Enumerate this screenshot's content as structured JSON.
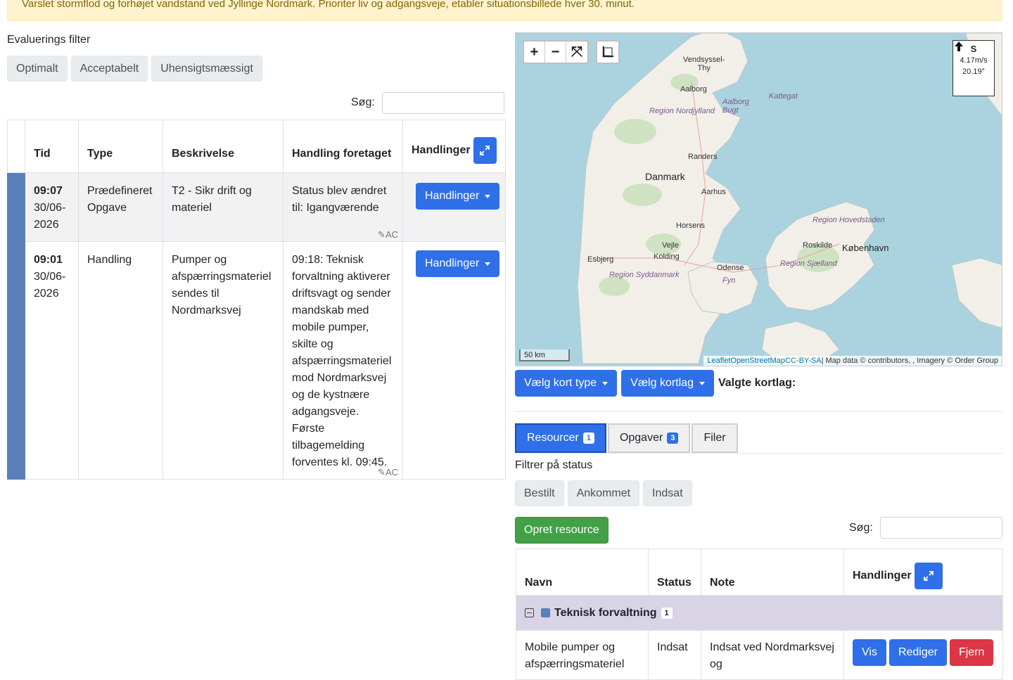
{
  "banner": {
    "text": "Varslet stormflod og forhøjet vandstand ved Jyllinge Nordmark. Prioriter liv og adgangsveje, etabler situationsbillede hver 30. minut."
  },
  "evaluation_filter": {
    "label": "Evaluerings filter",
    "buttons": [
      "Optimalt",
      "Acceptabelt",
      "Uhensigtsmæssigt"
    ]
  },
  "events_search": {
    "label": "Søg:",
    "value": ""
  },
  "events_table": {
    "headers": {
      "time": "Tid",
      "type": "Type",
      "description": "Beskrivelse",
      "action": "Handling foretaget",
      "actions": "Handlinger"
    },
    "rows": [
      {
        "time": "09:07",
        "date": "30/06-2026",
        "type": "Prædefineret Opgave",
        "description": "T2 - Sikr drift og materiel",
        "action": "Status blev ændret til: Igangværende",
        "author": "✎AC",
        "actions_label": "Handlinger"
      },
      {
        "time": "09:01",
        "date": "30/06-2026",
        "type": "Handling",
        "description": "Pumper og afspærringsmateriel sendes til Nordmarksvej",
        "action": "09:18: Teknisk forvaltning aktiverer driftsvagt og sender mandskab med mobile pumper, skilte og afspærringsmateriel mod Nordmarksvej og de kystnære adgangsveje. Første tilbagemelding forventes kl. 09:45.",
        "author": "✎AC",
        "actions_label": "Handlinger"
      }
    ]
  },
  "map": {
    "labels": {
      "vendsyssel": "Vendsyssel-\nThy",
      "aalborg": "Aalborg",
      "aalborg_bugt": "Aalborg\nBugt",
      "kattegat": "Kattegat",
      "region_nord": "Region Nordjylland",
      "randers": "Randers",
      "danmark": "Danmark",
      "aarhus": "Aarhus",
      "horsens": "Horsens",
      "region_hoved": "Region Hovedstaden",
      "roskilde": "Roskilde",
      "kobenhavn": "København",
      "vejle": "Vejle",
      "kolding": "Kolding",
      "esbjerg": "Esbjerg",
      "odense": "Odense",
      "fyn": "Fyn",
      "region_sjaelland": "Region Sjælland",
      "region_syd": "Region Syddanmark"
    },
    "wind": {
      "direction": "S",
      "speed": "4.17m/s",
      "degrees": "20.19°"
    },
    "scale": "50 km",
    "attribution": {
      "leaflet": "Leaflet",
      "osm": "OpenStreetMap",
      "cc": "CC-BY-SA",
      "rest": "| Map data © contributors, , Imagery © Order Group"
    },
    "controls": {
      "zoom_in": "+",
      "zoom_out": "−",
      "fit": "⤧"
    }
  },
  "map_tools": {
    "map_type": "Vælg kort type",
    "layer": "Vælg kortlag",
    "selected_layers": "Valgte kortlag:"
  },
  "tabs": [
    {
      "label": "Resourcer",
      "count": "1"
    },
    {
      "label": "Opgaver",
      "count": "3"
    },
    {
      "label": "Filer",
      "count": ""
    }
  ],
  "status_filter": {
    "label": "Filtrer på status",
    "buttons": [
      "Bestilt",
      "Ankommet",
      "Indsat"
    ]
  },
  "create_resource": "Opret resource",
  "resources_search": {
    "label": "Søg:",
    "value": ""
  },
  "resources_table": {
    "headers": {
      "name": "Navn",
      "status": "Status",
      "note": "Note",
      "actions": "Handlinger"
    },
    "group": {
      "name": "Teknisk forvaltning",
      "count": "1"
    },
    "rows": [
      {
        "name": "Mobile pumper og afspærringsmateriel",
        "status": "Indsat",
        "note": "Indsat ved Nordmarksvej og",
        "buttons": {
          "view": "Vis",
          "edit": "Rediger",
          "remove": "Fjern"
        }
      }
    ]
  },
  "colors": {
    "primary": "#2f6fe8",
    "success": "#43a047",
    "danger": "#dc3545",
    "stripe": "#5b7fb8",
    "banner": "#fff3cd"
  }
}
